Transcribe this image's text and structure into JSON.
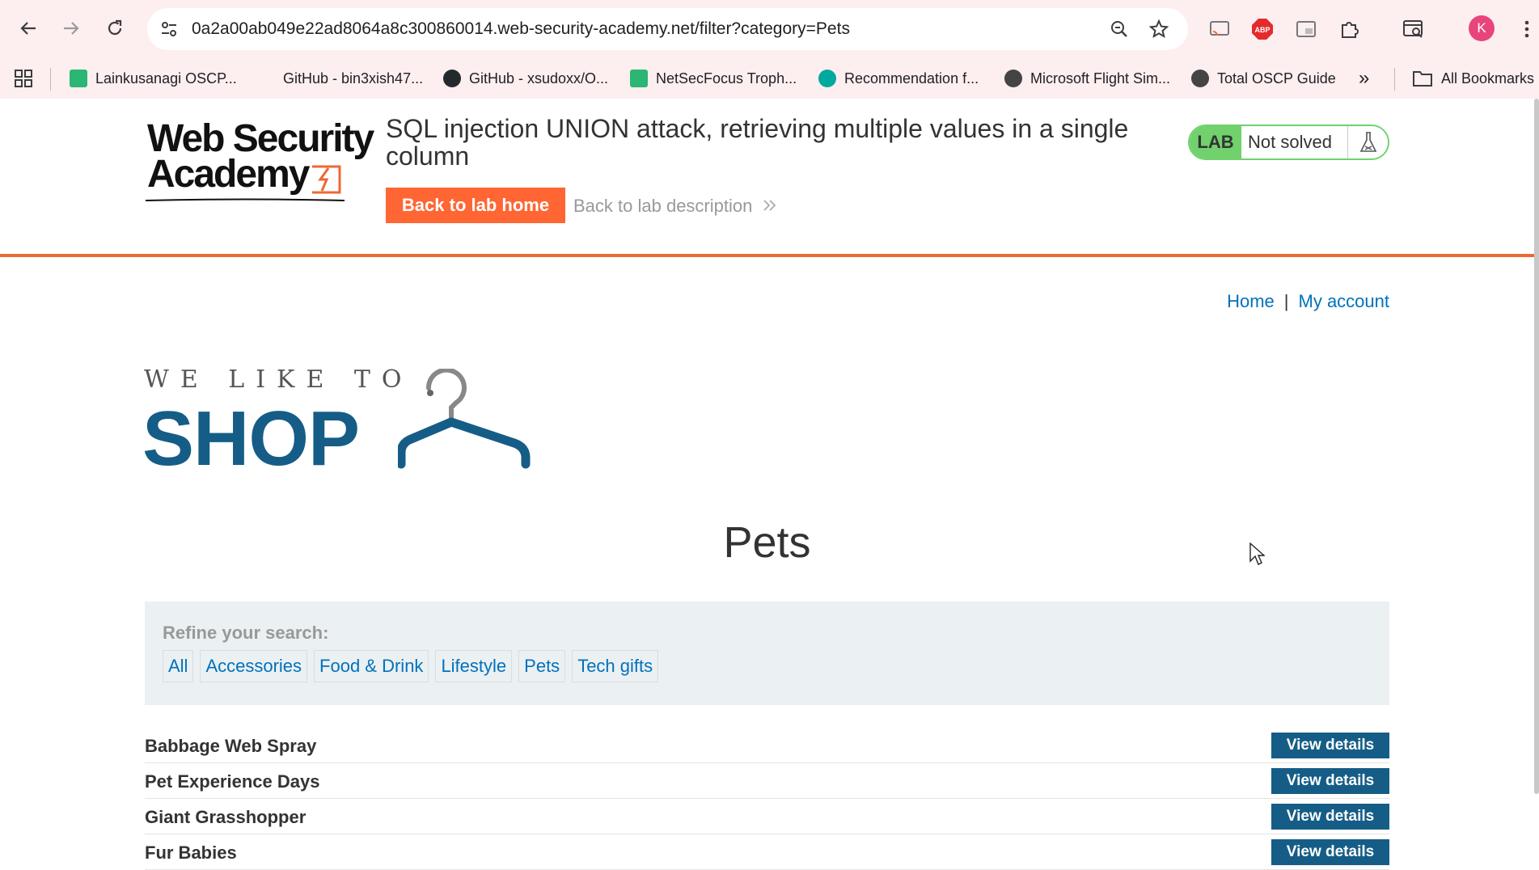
{
  "browser": {
    "url": "0a2a00ab049e22ad8064a8c300860014.web-security-academy.net/filter?category=Pets",
    "profile_initial": "K",
    "bookmarks": [
      {
        "label": "Lainkusanagi OSCP...",
        "icon_color": "#2bb673"
      },
      {
        "label": "GitHub - bin3xish47...",
        "icon_color": "#fdeef0"
      },
      {
        "label": "GitHub - xsudoxx/O...",
        "icon_color": "#24292e"
      },
      {
        "label": "NetSecFocus Troph...",
        "icon_color": "#2bb673"
      },
      {
        "label": "Recommendation f...",
        "icon_color": "#00a99d"
      },
      {
        "label": "Microsoft Flight Sim...",
        "icon_color": "#444444"
      },
      {
        "label": "Total OSCP Guide",
        "icon_color": "#444444"
      }
    ],
    "more_label": "»",
    "all_bookmarks_label": "All Bookmarks"
  },
  "lab": {
    "logo_line1": "Web Security",
    "logo_line2": "Academy",
    "title": "SQL injection UNION attack, retrieving multiple values in a single column",
    "back_home_label": "Back to lab home",
    "back_desc_label": "Back to lab description",
    "badge_label": "LAB",
    "status": "Not solved"
  },
  "nav": {
    "home": "Home",
    "separator": "|",
    "account": "My account"
  },
  "shop": {
    "tagline": "WE LIKE TO",
    "word": "SHOP"
  },
  "page": {
    "title": "Pets",
    "refine_label": "Refine your search:",
    "categories": [
      "All",
      "Accessories",
      "Food & Drink",
      "Lifestyle",
      "Pets",
      "Tech gifts"
    ]
  },
  "products": [
    {
      "name": "Babbage Web Spray",
      "action": "View details"
    },
    {
      "name": "Pet Experience Days",
      "action": "View details"
    },
    {
      "name": "Giant Grasshopper",
      "action": "View details"
    },
    {
      "name": "Fur Babies",
      "action": "View details"
    }
  ],
  "colors": {
    "accent_orange": "#ff6633",
    "lab_green": "#70d16d",
    "link_blue": "#0071bc",
    "shop_blue": "#155d86"
  }
}
